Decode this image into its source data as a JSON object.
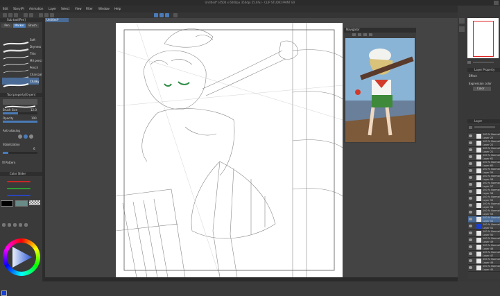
{
  "app": {
    "title": "Untitled* (4500 x 6000px 350dpi 25.6%) - CLIP STUDIO PAINT EX"
  },
  "menu": [
    "Edit",
    "Story(P)",
    "Animation",
    "Layer",
    "Select",
    "View",
    "Filter",
    "Window",
    "Help"
  ],
  "document_tab": "Untitled*",
  "left_panel": {
    "sub_tool_header": "Sub tool[Pen]",
    "sub_tool_tabs": [
      "Pen",
      "Marker",
      "Brush"
    ],
    "brushes": [
      "Soft",
      "Dryness",
      "Thin",
      "Mil pencil",
      "Pencil",
      "Charcoal",
      "Chalky"
    ],
    "tool_property_header": "Tool property[G-pen]",
    "brush_size_label": "Brush Size",
    "brush_size_value": "12.0",
    "opacity_label": "Opacity",
    "opacity_value": "100",
    "anti_alias_label": "Anti-aliasing",
    "stabilization_label": "Stabilization",
    "stabilization_value": "6",
    "vector_label": "Pattern",
    "color_slider_header": "Color Slider"
  },
  "navigator": {
    "title": "Navigator"
  },
  "right_panel": {
    "layer_property_header": "Layer Property",
    "effect_label": "Effect",
    "expression_color_label": "Expression color",
    "expression_color_value": "Color",
    "layer_header": "Layer",
    "layers": [
      {
        "label": "100 % Normal Layer 23"
      },
      {
        "label": "100 % Normal Layer 22"
      },
      {
        "label": "100 % Normal Layer 21"
      },
      {
        "label": "100 % Normal Layer 61"
      },
      {
        "label": "100 % Normal Layer 60"
      },
      {
        "label": "100 % Normal Layer 59"
      },
      {
        "label": "100 % Normal Layer 58"
      },
      {
        "label": "100 % Normal Layer 57"
      },
      {
        "label": "100 % Normal Layer 56"
      },
      {
        "label": "100 % Normal Layer 55"
      },
      {
        "label": "100 % Normal Layer 54"
      },
      {
        "label": "100 % Normal Layer 53"
      },
      {
        "label": "100 % Normal Layer 52"
      },
      {
        "label": "100 % Normal Layer 51"
      },
      {
        "label": "100 % Normal Layer 50"
      },
      {
        "label": "100 % Normal Layer 49"
      },
      {
        "label": "100 % Normal Layer 48"
      },
      {
        "label": "100 % Normal Layer 47"
      },
      {
        "label": "100 % Normal Layer 46"
      },
      {
        "label": "100 % Normal Layer 45"
      }
    ]
  },
  "colors": {
    "accent": "#4a7bb8",
    "main_color": "#000000",
    "sub_color": "#ffffff",
    "layer_color_swatch": "#1a3fd0"
  }
}
